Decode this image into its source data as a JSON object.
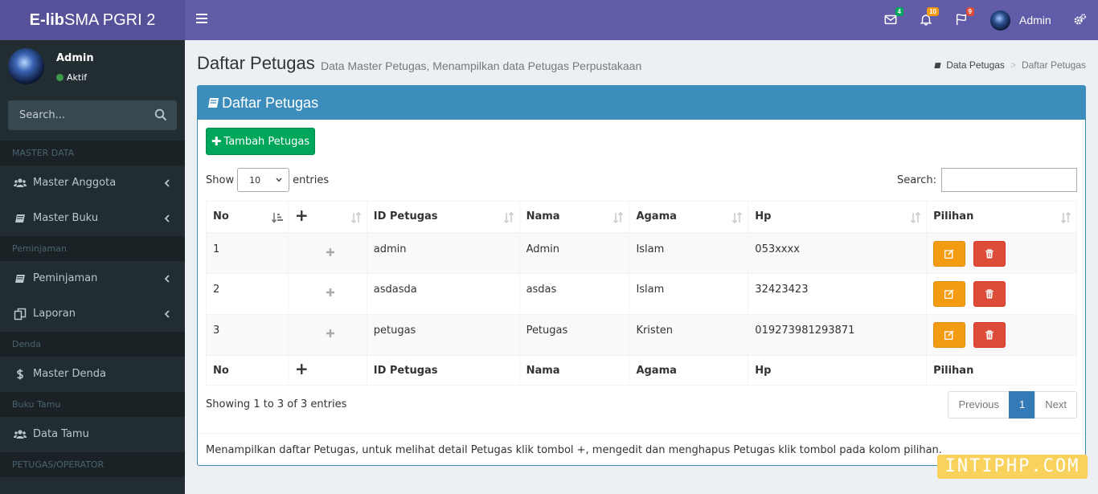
{
  "brand": {
    "bold": "E-lib",
    "rest": "SMA PGRI 2"
  },
  "topbar": {
    "messages_badge": "4",
    "notifications_badge": "10",
    "tasks_badge": "9",
    "user_name": "Admin",
    "colors": {
      "green": "#00a65a",
      "orange": "#f39c12",
      "red": "#dd4b39"
    }
  },
  "sidebar": {
    "user": {
      "name": "Admin",
      "status": "Aktif"
    },
    "search_placeholder": "Search...",
    "sections": [
      {
        "header": "MASTER DATA",
        "items": [
          {
            "label": "Master Anggota",
            "icon": "users-icon",
            "has_children": true
          },
          {
            "label": "Master Buku",
            "icon": "book-icon",
            "has_children": true
          }
        ]
      },
      {
        "header": "Peminjaman",
        "items": [
          {
            "label": "Peminjaman",
            "icon": "book-icon",
            "has_children": true
          },
          {
            "label": "Laporan",
            "icon": "copy-icon",
            "has_children": true
          }
        ]
      },
      {
        "header": "Denda",
        "items": [
          {
            "label": "Master Denda",
            "icon": "dollar-icon",
            "has_children": false
          }
        ]
      },
      {
        "header": "Buku Tamu",
        "items": [
          {
            "label": "Data Tamu",
            "icon": "users-icon",
            "has_children": false
          }
        ]
      },
      {
        "header": "PETUGAS/OPERATOR",
        "items": []
      }
    ]
  },
  "page": {
    "title": "Daftar Petugas",
    "subtitle": "Data Master Petugas, Menampilkan data Petugas Perpustakaan",
    "breadcrumb": {
      "parent": "Data Petugas",
      "separator": ">",
      "current": "Daftar Petugas"
    }
  },
  "box": {
    "title": "Daftar Petugas",
    "add_button": "Tambah Petugas",
    "show_label": "Show",
    "entries_label": "entries",
    "page_length": "10",
    "search_label": "Search:",
    "search_value": "",
    "columns": [
      "No",
      "+",
      "ID Petugas",
      "Nama",
      "Agama",
      "Hp",
      "Pilihan"
    ],
    "rows": [
      {
        "no": "1",
        "id": "admin",
        "nama": "Admin",
        "agama": "Islam",
        "hp": "053xxxx"
      },
      {
        "no": "2",
        "id": "asdasda",
        "nama": "asdas",
        "agama": "Islam",
        "hp": "32423423"
      },
      {
        "no": "3",
        "id": "petugas",
        "nama": "Petugas",
        "agama": "Kristen",
        "hp": "019273981293871"
      }
    ],
    "info": "Showing 1 to 3 of 3 entries",
    "pagination": {
      "previous": "Previous",
      "current": "1",
      "next": "Next"
    },
    "footer": "Menampilkan daftar Petugas, untuk melihat detail Petugas klik tombol +, mengedit dan menghapus Petugas klik tombol pada kolom pilihan."
  },
  "watermark": "INTIPHP.COM"
}
